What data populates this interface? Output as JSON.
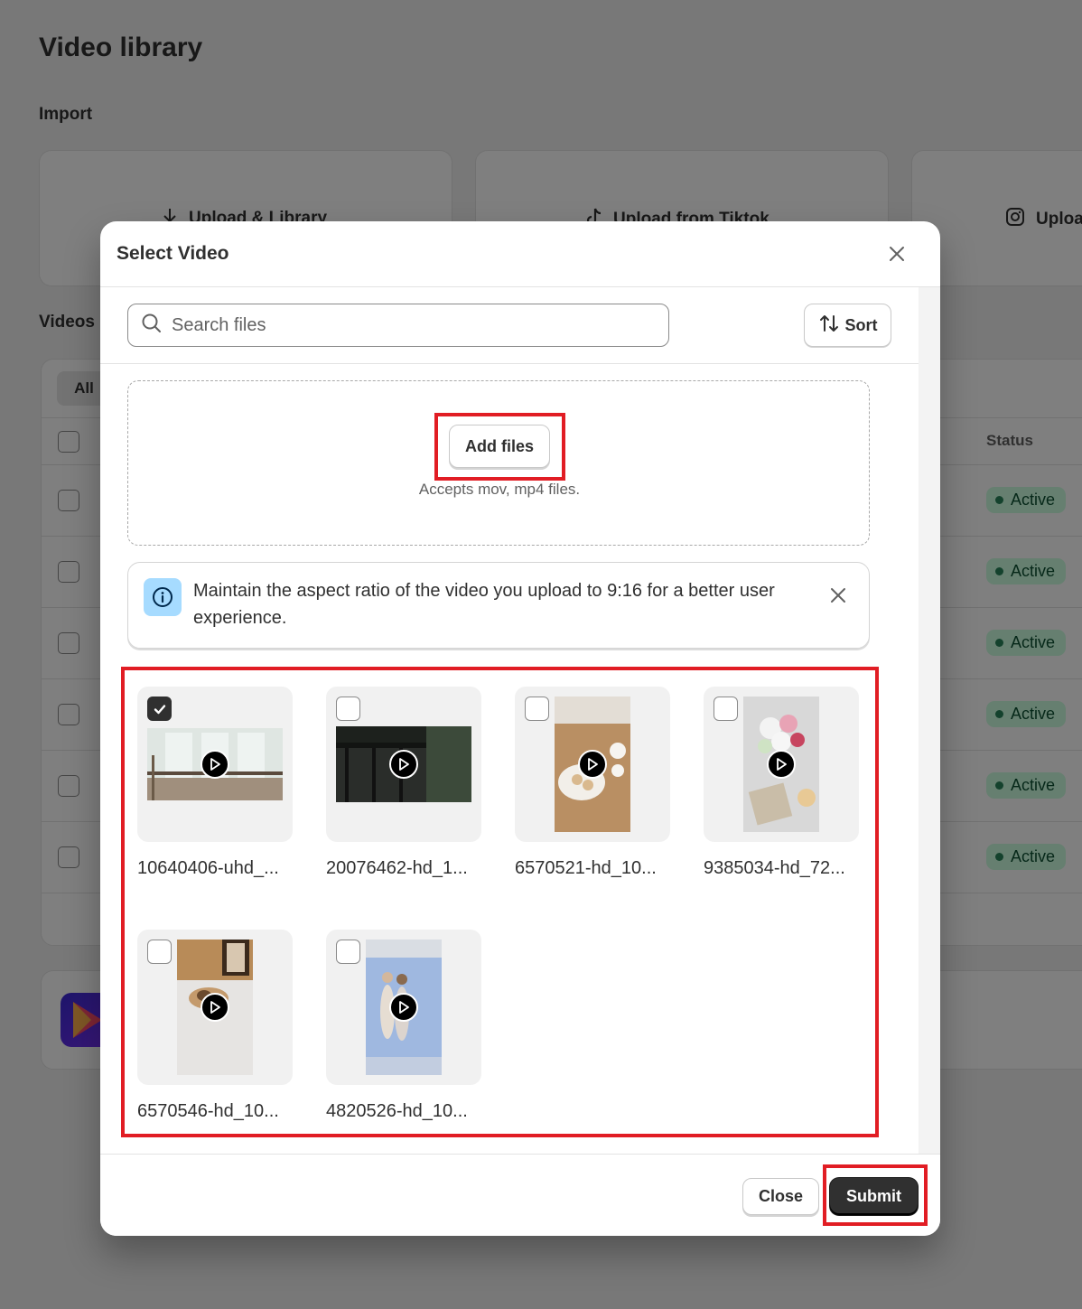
{
  "page": {
    "title": "Video library",
    "import_heading": "Import",
    "import_cards": [
      {
        "label": "Upload & Library",
        "icon": "download-arrow-icon"
      },
      {
        "label": "Upload from Tiktok",
        "icon": "tiktok-icon"
      },
      {
        "label": "Uploa",
        "icon": "instagram-icon"
      }
    ],
    "videos_heading": "Videos",
    "filter_tab": "All",
    "status_column": "Status",
    "status_values": [
      "Active",
      "Active",
      "Active",
      "Active",
      "Active",
      "Active"
    ]
  },
  "modal": {
    "title": "Select Video",
    "search": {
      "placeholder": "Search files",
      "value": ""
    },
    "sort_label": "Sort",
    "dropzone": {
      "button_label": "Add files",
      "hint": "Accepts mov, mp4 files."
    },
    "banner": {
      "text": "Maintain the aspect ratio of the video you upload to 9:16 for a better user experience.",
      "icon": "info-icon"
    },
    "videos": [
      {
        "name": "10640406-uhd_...",
        "checked": true
      },
      {
        "name": "20076462-hd_1...",
        "checked": false
      },
      {
        "name": "6570521-hd_10...",
        "checked": false
      },
      {
        "name": "9385034-hd_72...",
        "checked": false
      },
      {
        "name": "6570546-hd_10...",
        "checked": false
      },
      {
        "name": "4820526-hd_10...",
        "checked": false
      }
    ],
    "footer": {
      "close_label": "Close",
      "submit_label": "Submit"
    }
  },
  "colors": {
    "primary_button": "#303030",
    "highlight": "#e11d24",
    "status_badge_bg": "#cdfee1",
    "status_badge_text": "#0c5132",
    "info_icon_bg": "#a6dbff"
  }
}
